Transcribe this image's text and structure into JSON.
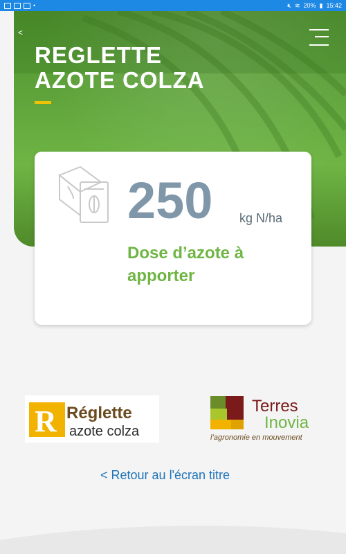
{
  "statusbar": {
    "battery": "20%",
    "time": "15:42"
  },
  "hero": {
    "title_line1": "REGLETTE",
    "title_line2": "AZOTE COLZA"
  },
  "result": {
    "value": "250",
    "unit": "kg N/ha",
    "label_line1": "Dose d’azote à",
    "label_line2": "apporter"
  },
  "logos": {
    "reglette_line1": "Réglette",
    "reglette_line2": "azote colza",
    "terres_line1": "Terres",
    "terres_line2": "Inovia",
    "terres_tagline": "l’agronomie en mouvement"
  },
  "footer": {
    "back_link": "< Retour au l'écran titre"
  },
  "colors": {
    "accent_green": "#6fb544",
    "value_grey": "#7f97a8",
    "link_blue": "#1e73b8",
    "statusbar_blue": "#1e88e5",
    "title_underline": "#f2c200"
  }
}
